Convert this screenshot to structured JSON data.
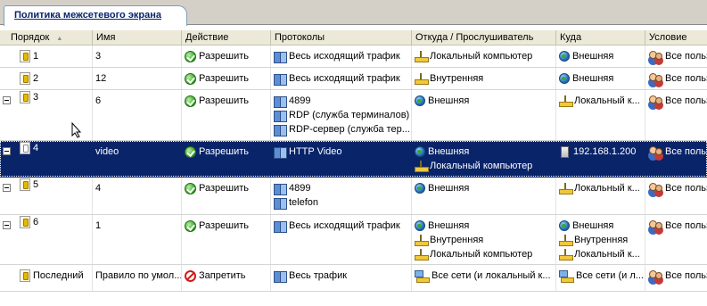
{
  "tab": {
    "title": "Политика межсетевого экрана"
  },
  "columns": [
    "Порядок",
    "Имя",
    "Действие",
    "Протоколы",
    "Откуда / Прослушиватель",
    "Куда",
    "Условие"
  ],
  "rows": [
    {
      "order": "1",
      "name": "3",
      "action": "Разрешить",
      "protocols": [
        "Весь исходящий трафик"
      ],
      "from": [
        "Локальный компьютер"
      ],
      "to": [
        "Внешняя"
      ],
      "condition": "Все польз"
    },
    {
      "order": "2",
      "name": "12",
      "action": "Разрешить",
      "protocols": [
        "Весь исходящий трафик"
      ],
      "from": [
        "Внутренняя"
      ],
      "to": [
        "Внешняя"
      ],
      "condition": "Все польз"
    },
    {
      "order": "3",
      "name": "6",
      "action": "Разрешить",
      "protocols": [
        "4899",
        "RDP (служба терминалов)",
        "RDP-сервер (служба тер..."
      ],
      "from": [
        "Внешняя"
      ],
      "to": [
        "Локальный к..."
      ],
      "condition": "Все польз"
    },
    {
      "order": "4",
      "name": "video",
      "action": "Разрешить",
      "protocols": [
        "HTTP Video"
      ],
      "from": [
        "Внешняя",
        "Локальный компьютер"
      ],
      "to": [
        "192.168.1.200"
      ],
      "condition": "Все польз"
    },
    {
      "order": "5",
      "name": "4",
      "action": "Разрешить",
      "protocols": [
        "4899",
        "telefon"
      ],
      "from": [
        "Внешняя"
      ],
      "to": [
        "Локальный к..."
      ],
      "condition": "Все польз"
    },
    {
      "order": "6",
      "name": "1",
      "action": "Разрешить",
      "protocols": [
        "Весь исходящий трафик"
      ],
      "from": [
        "Внешняя",
        "Внутренняя",
        "Локальный компьютер"
      ],
      "to": [
        "Внешняя",
        "Внутренняя",
        "Локальный к..."
      ],
      "condition": "Все польз"
    },
    {
      "order": "Последний",
      "name": "Правило по умол...",
      "action": "Запретить",
      "protocols": [
        "Весь трафик"
      ],
      "from": [
        "Все сети (и локальный к..."
      ],
      "to": [
        "Все сети (и л..."
      ],
      "condition": "Все польз"
    }
  ]
}
